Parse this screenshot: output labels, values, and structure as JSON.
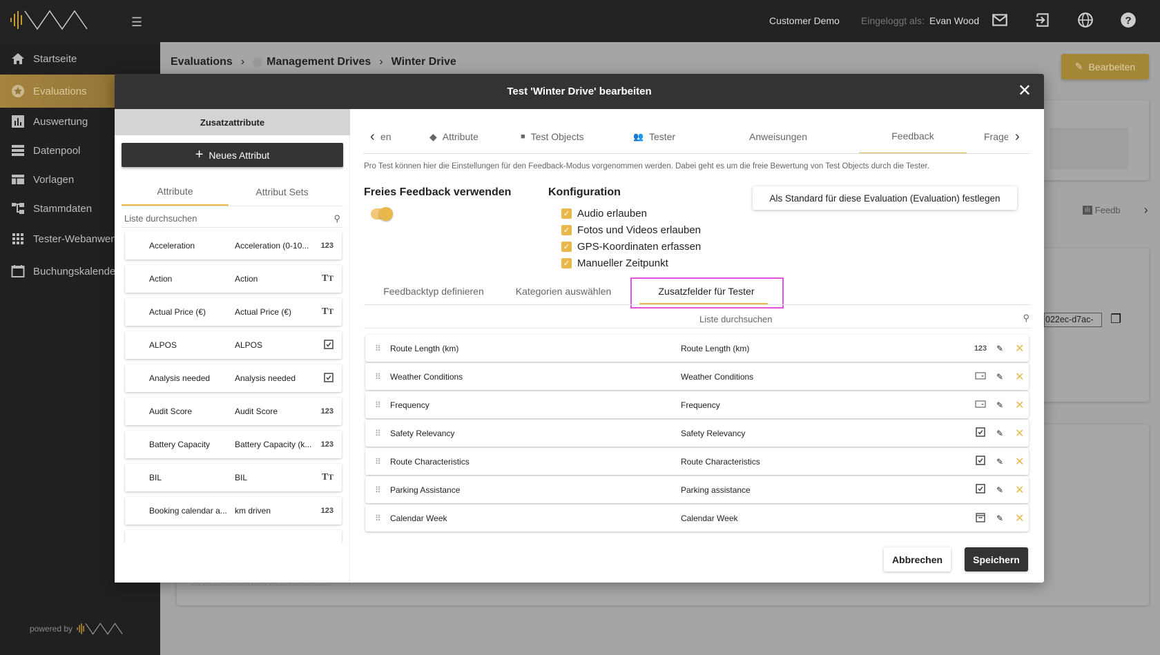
{
  "topbar": {
    "customer": "Customer Demo",
    "logged_in_label": "Eingeloggt als:",
    "user": "Evan Wood",
    "icons": [
      "mail-icon",
      "logout-icon",
      "globe-icon",
      "help-icon"
    ]
  },
  "sidebar": {
    "items": [
      {
        "label": "Startseite",
        "icon": "home-icon"
      },
      {
        "label": "Evaluations",
        "icon": "star-icon",
        "active": true
      },
      {
        "label": "Auswertung",
        "icon": "bar-chart-icon"
      },
      {
        "label": "Datenpool",
        "icon": "database-icon"
      },
      {
        "label": "Vorlagen",
        "icon": "template-icon"
      },
      {
        "label": "Stammdaten",
        "icon": "hierarchy-icon"
      },
      {
        "label": "Tester-Webanwendung",
        "icon": "apps-icon"
      },
      {
        "label": "Buchungskalender",
        "icon": "calendar-icon"
      }
    ],
    "powered_by": "powered by"
  },
  "breadcrumb": [
    "Evaluations",
    "Management Drives",
    "Winter Drive"
  ],
  "page": {
    "edit_button": "Bearbeiten",
    "bg_tab": "Feedb",
    "bg_id": "022ec-d7ac-"
  },
  "modal": {
    "title": "Test 'Winter Drive' bearbeiten",
    "left": {
      "header": "Zusatzattribute",
      "new_button": "Neues Attribut",
      "tabs": [
        "Attribute",
        "Attribut Sets"
      ],
      "search_placeholder": "Liste durchsuchen",
      "rows": [
        {
          "name": "Acceleration",
          "label": "Acceleration (0-10...",
          "type": "123"
        },
        {
          "name": "Action",
          "label": "Action",
          "type": "text"
        },
        {
          "name": "Actual Price (€)",
          "label": "Actual Price (€)",
          "type": "text"
        },
        {
          "name": "ALPOS",
          "label": "ALPOS",
          "type": "checkbox"
        },
        {
          "name": "Analysis needed",
          "label": "Analysis needed",
          "type": "checkbox"
        },
        {
          "name": "Audit Score",
          "label": "Audit Score",
          "type": "123"
        },
        {
          "name": "Battery Capacity",
          "label": "Battery Capacity (k...",
          "type": "123"
        },
        {
          "name": "BIL",
          "label": "BIL",
          "type": "text"
        },
        {
          "name": "Booking calendar a...",
          "label": "km driven",
          "type": "123"
        }
      ]
    },
    "tabs": [
      {
        "label": "en"
      },
      {
        "label": "Attribute",
        "icon": "tag-icon"
      },
      {
        "label": "Test Objects",
        "icon": "car-icon"
      },
      {
        "label": "Tester",
        "icon": "people-icon"
      },
      {
        "label": "Anweisungen"
      },
      {
        "label": "Feedback",
        "active": true
      },
      {
        "label": "Frage"
      }
    ],
    "description": "Pro Test können hier die Einstellungen für den Feedback-Modus vorgenommen werden. Dabei geht es um die freie Bewertung von Test Objects durch die Tester.",
    "free_feedback": {
      "title": "Freies Feedback verwenden",
      "enabled": true
    },
    "config": {
      "title": "Konfiguration",
      "options": [
        {
          "label": "Audio erlauben",
          "checked": true
        },
        {
          "label": "Fotos und Videos erlauben",
          "checked": true
        },
        {
          "label": "GPS-Koordinaten erfassen",
          "checked": true
        },
        {
          "label": "Manueller Zeitpunkt",
          "checked": true
        }
      ]
    },
    "default_button": "Als Standard für diese Evaluation (Evaluation) festlegen",
    "subtabs": [
      "Feedbacktyp definieren",
      "Kategorien auswählen",
      "Zusatzfelder für Tester"
    ],
    "active_subtab": "Zusatzfelder für Tester",
    "search_placeholder": "Liste durchsuchen",
    "rows": [
      {
        "name": "Route Length (km)",
        "label": "Route Length (km)",
        "type": "123"
      },
      {
        "name": "Weather Conditions",
        "label": "Weather Conditions",
        "type": "dropdown"
      },
      {
        "name": "Frequency",
        "label": "Frequency",
        "type": "dropdown"
      },
      {
        "name": "Safety Relevancy",
        "label": "Safety Relevancy",
        "type": "checkbox"
      },
      {
        "name": "Route Characteristics",
        "label": "Route Characteristics",
        "type": "checkbox"
      },
      {
        "name": "Parking Assistance",
        "label": "Parking assistance",
        "type": "checkbox"
      },
      {
        "name": "Calendar Week",
        "label": "Calendar Week",
        "type": "calendar"
      }
    ],
    "cancel": "Abbrechen",
    "save": "Speichern"
  },
  "colors": {
    "accent": "#e8b84a",
    "dark": "#333333",
    "highlight": "#e052e0"
  }
}
